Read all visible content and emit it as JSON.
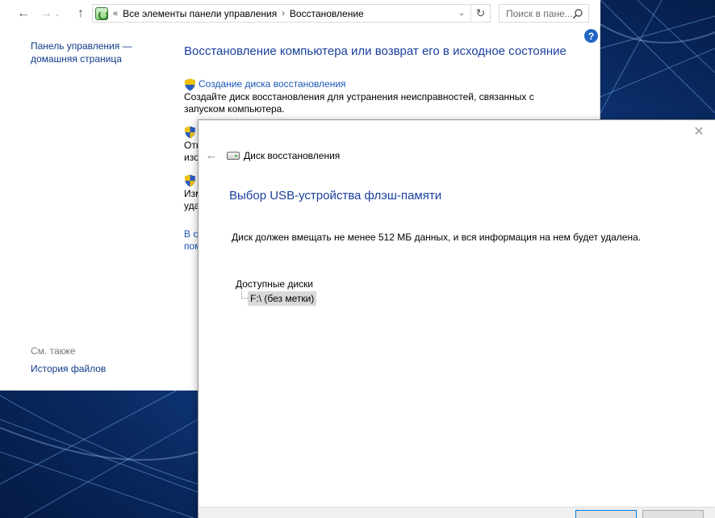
{
  "explorer": {
    "address": {
      "overflow": "«",
      "crumbs": [
        "Все элементы панели управления",
        "Восстановление"
      ],
      "separator": "›"
    },
    "search": {
      "placeholder": "Поиск в пане..."
    },
    "help_label": "?"
  },
  "sidebar": {
    "home_link": "Панель управления — домашняя страница",
    "see_also": "См. также",
    "file_history": "История файлов"
  },
  "main": {
    "title": "Восстановление компьютера или возврат его в исходное состояние",
    "tasks": [
      {
        "link": "Создание диска восстановления",
        "description": "Создайте диск восстановления для устранения неисправностей, связанных с запуском компьютера."
      },
      {
        "line1": "Отк",
        "line2": "изо"
      },
      {
        "line1": "Изм",
        "line2": "уда"
      }
    ],
    "extra_link": {
      "line1": "В с",
      "line2": "пом"
    }
  },
  "wizard": {
    "close_label": "✕",
    "back_label": "←",
    "heading": "Диск восстановления",
    "title": "Выбор USB-устройства флэш-памяти",
    "description": "Диск должен вмещать не менее 512 МБ данных, и вся информация на нем будет удалена.",
    "drives_label": "Доступные диски",
    "drives": [
      "F:\\ (без метки)"
    ]
  },
  "colors": {
    "link": "#1a56b8",
    "title": "#1a3f9c",
    "sidebar_link": "#0f3a8a",
    "desktop": "#0a2a62"
  }
}
